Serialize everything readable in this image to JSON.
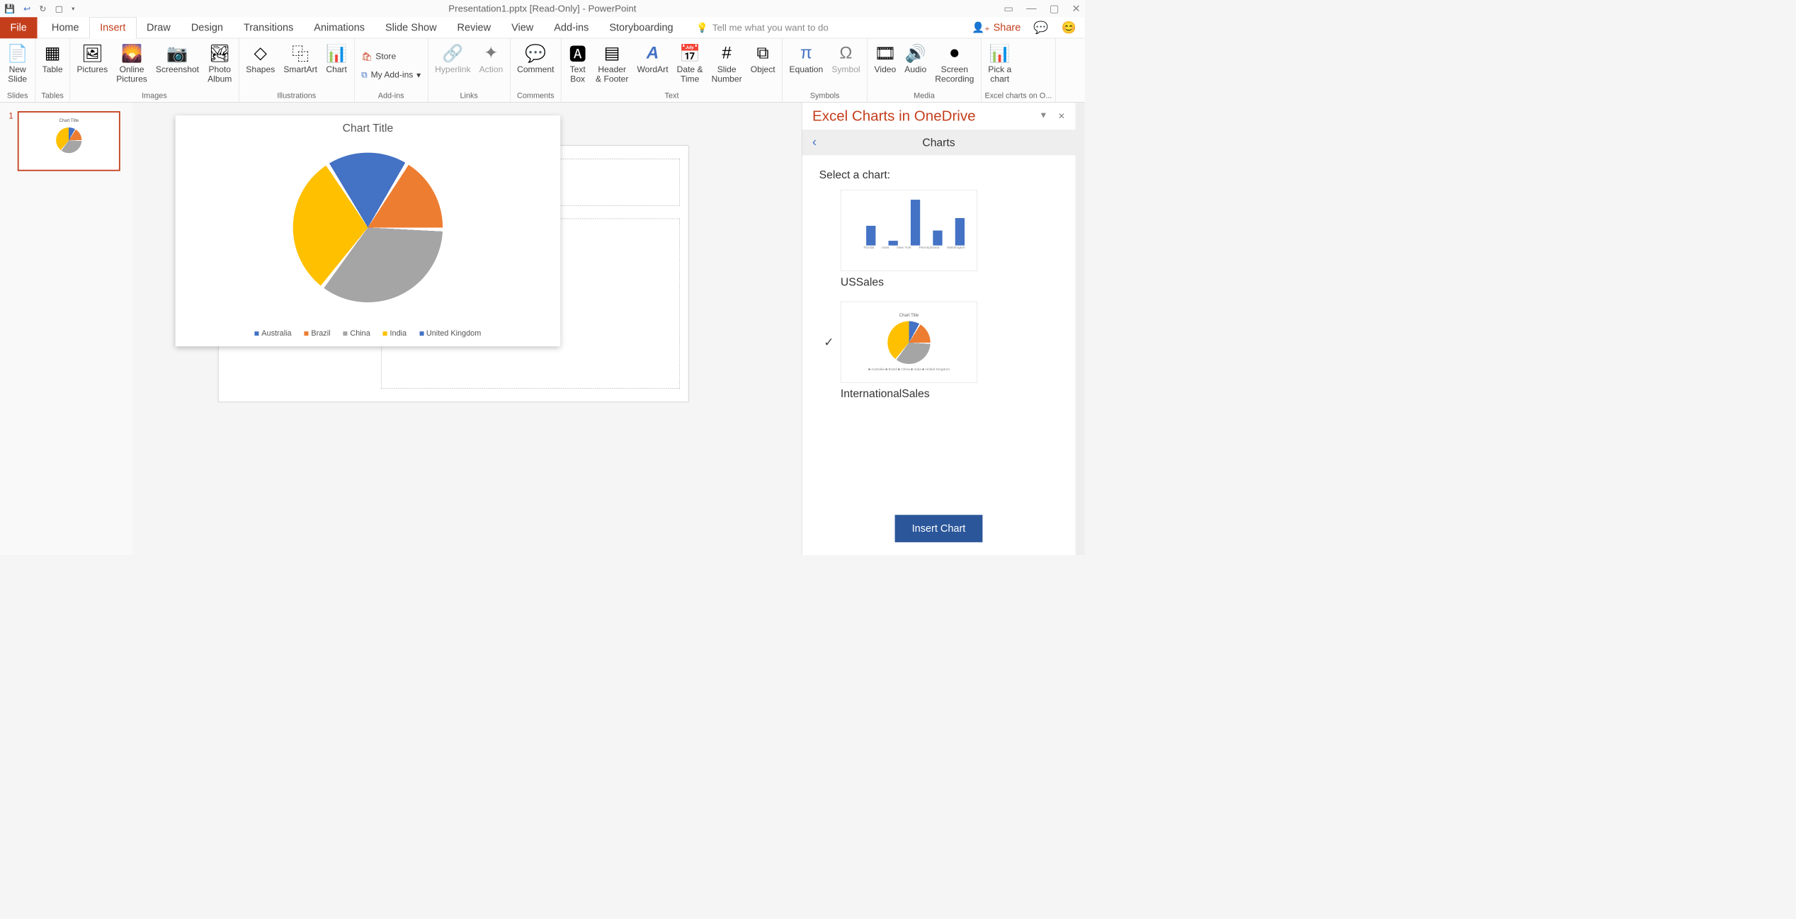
{
  "titlebar": {
    "title": "Presentation1.pptx [Read-Only] - PowerPoint"
  },
  "tabs": {
    "file": "File",
    "home": "Home",
    "insert": "Insert",
    "draw": "Draw",
    "design": "Design",
    "transitions": "Transitions",
    "animations": "Animations",
    "slideshow": "Slide Show",
    "review": "Review",
    "view": "View",
    "addins": "Add-ins",
    "storyboarding": "Storyboarding"
  },
  "tellme": "Tell me what you want to do",
  "share": "Share",
  "ribbon": {
    "slides": {
      "new_slide": "New\nSlide",
      "group": "Slides"
    },
    "tables": {
      "table": "Table",
      "group": "Tables"
    },
    "images": {
      "pictures": "Pictures",
      "online_pictures": "Online\nPictures",
      "screenshot": "Screenshot",
      "photo_album": "Photo\nAlbum",
      "group": "Images"
    },
    "illustrations": {
      "shapes": "Shapes",
      "smartart": "SmartArt",
      "chart": "Chart",
      "group": "Illustrations"
    },
    "addins": {
      "store": "Store",
      "my_addins": "My Add-ins",
      "group": "Add-ins"
    },
    "links": {
      "hyperlink": "Hyperlink",
      "action": "Action",
      "group": "Links"
    },
    "comments": {
      "comment": "Comment",
      "group": "Comments"
    },
    "text": {
      "text_box": "Text\nBox",
      "header_footer": "Header\n& Footer",
      "wordart": "WordArt",
      "date_time": "Date &\nTime",
      "slide_number": "Slide\nNumber",
      "object": "Object",
      "group": "Text"
    },
    "symbols": {
      "equation": "Equation",
      "symbol": "Symbol",
      "group": "Symbols"
    },
    "media": {
      "video": "Video",
      "audio": "Audio",
      "screen_recording": "Screen\nRecording",
      "group": "Media"
    },
    "excel_charts": {
      "pick_a_chart": "Pick a\nchart",
      "group": "Excel charts on O..."
    }
  },
  "slidenav": {
    "slide1_num": "1"
  },
  "chart_data": {
    "type": "pie",
    "title": "Chart Title",
    "categories": [
      "Australia",
      "Brazil",
      "China",
      "India",
      "United Kingdom"
    ],
    "values": [
      8,
      16,
      34,
      30,
      12
    ],
    "colors": [
      "#4472C4",
      "#ED7D31",
      "#A5A5A5",
      "#FFC000",
      "#4472C4"
    ]
  },
  "pane": {
    "title": "Excel Charts in OneDrive",
    "crumb": "Charts",
    "select_label": "Select a chart:",
    "chart1_name": "USSales",
    "chart2_name": "InternationalSales",
    "chart2_title": "Chart Title",
    "chart2_legend": "■ Australia   ■ Brazil   ■ China   ■ India   ■ United Kingdom",
    "insert_button": "Insert Chart",
    "ussales_data": {
      "type": "bar",
      "categories": [
        "Florida",
        "Iowa",
        "New York",
        "Pennsylvania",
        "Washington"
      ],
      "values": [
        120000,
        30000,
        290000,
        95000,
        170000
      ],
      "ylim": [
        0,
        300000
      ],
      "yticks": [
        0,
        50000,
        100000,
        150000,
        200000,
        250000,
        300000
      ]
    }
  }
}
